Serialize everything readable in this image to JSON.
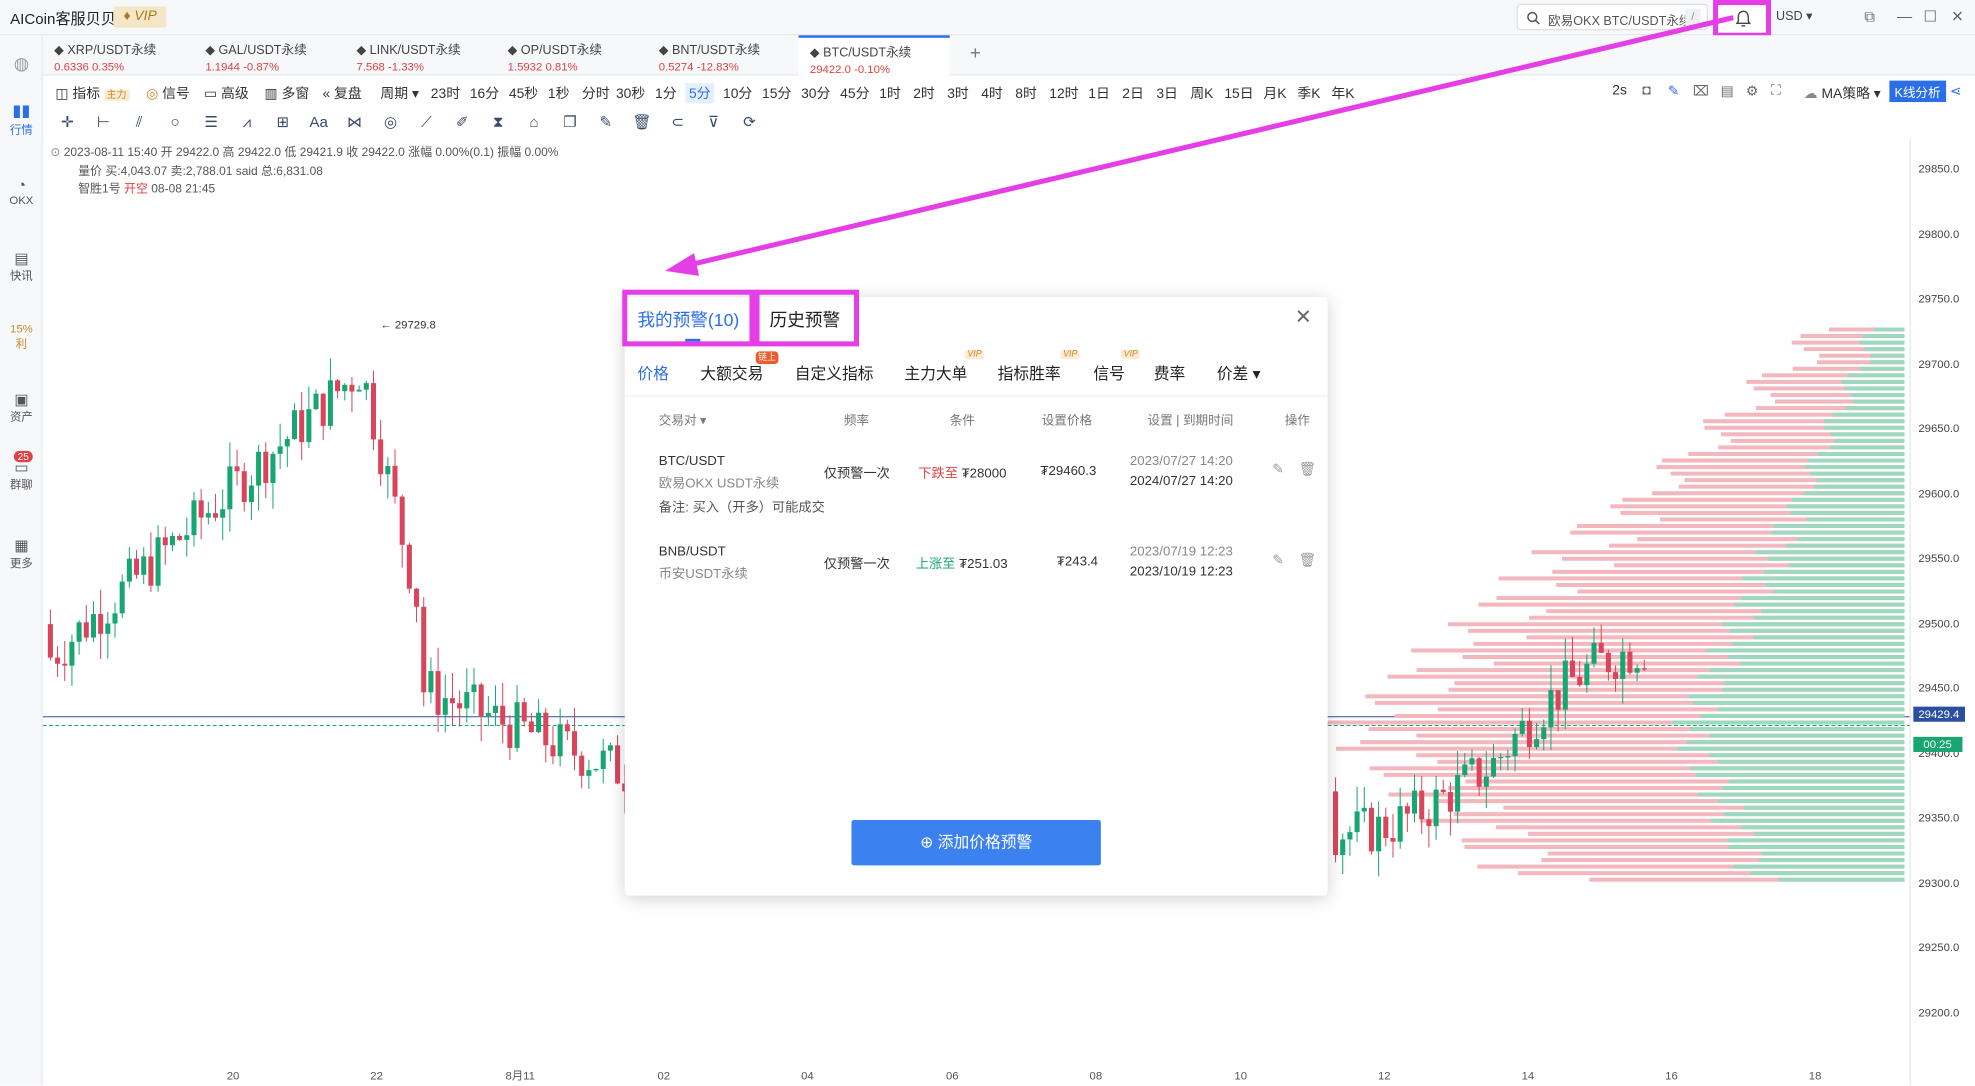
{
  "app": {
    "title": "AICoin客服贝贝",
    "vip": "VIP",
    "search_placeholder": "欧易OKX BTC/USDT永续",
    "search_shortcut": "/",
    "currency": "USD"
  },
  "tabs": [
    {
      "name": "XRP/USDT永续",
      "price": "0.6336",
      "change": "0.35%",
      "dir": "up"
    },
    {
      "name": "GAL/USDT永续",
      "price": "1.1944",
      "change": "-0.87%",
      "dir": "up"
    },
    {
      "name": "LINK/USDT永续",
      "price": "7.568",
      "change": "-1.33%",
      "dir": "up"
    },
    {
      "name": "OP/USDT永续",
      "price": "1.5932",
      "change": "0.81%",
      "dir": "up"
    },
    {
      "name": "BNT/USDT永续",
      "price": "0.5274",
      "change": "-12.83%",
      "dir": "up"
    },
    {
      "name": "BTC/USDT永续",
      "price": "29422.0",
      "change": "-0.10%",
      "dir": "up"
    }
  ],
  "toolbar": {
    "indicator": "指标",
    "main_badge": "主力",
    "signal": "信号",
    "advanced": "高级",
    "multi_window": "多窗",
    "replay": "复盘",
    "period": "周期",
    "intervals": [
      "23时",
      "16分",
      "45秒",
      "1秒",
      "分时",
      "30秒",
      "1分",
      "5分",
      "10分",
      "15分",
      "30分",
      "45分",
      "1时",
      "2时",
      "3时",
      "4时",
      "8时",
      "12时",
      "1日",
      "2日",
      "3日",
      "周K",
      "15日",
      "月K",
      "季K",
      "年K"
    ],
    "selected_interval": "5分",
    "refresh": "2s",
    "ma_strategy": "MA策略",
    "kline_analysis": "K线分析"
  },
  "leftrail": {
    "market": "行情",
    "okx": "OKX",
    "news": "快讯",
    "percent": "15%",
    "profit": "利",
    "assets": "资产",
    "chat": "群聊",
    "chat_badge": "25",
    "more": "更多"
  },
  "chart_info": {
    "line1": "2023-08-11 15:40  开 29422.0  高 29422.0  低 29421.9  收 29422.0  涨幅 0.00%(0.1)  振幅 0.00%",
    "line2": "量价 买:4,043.07 卖:2,788.01 said 总:6,831.08",
    "line3_name": "智胜1号",
    "line3_action": "开空",
    "line3_time": "08-08 21:45",
    "peak_label": "← 29729.8"
  },
  "price_axis": {
    "ticks": [
      "29850.0",
      "29800.0",
      "29750.0",
      "29700.0",
      "29650.0",
      "29600.0",
      "29550.0",
      "29500.0",
      "29450.0",
      "29400.0",
      "29350.0",
      "29300.0",
      "29250.0",
      "29200.0"
    ],
    "current_price": "29429.4",
    "countdown": "00:25"
  },
  "time_axis": [
    "20",
    "22",
    "8月11",
    "02",
    "04",
    "06",
    "08",
    "10",
    "12",
    "14",
    "16",
    "18"
  ],
  "modal": {
    "tab_mine": "我的预警(10)",
    "tab_history": "历史预警",
    "subtabs": [
      "价格",
      "大额交易",
      "自定义指标",
      "主力大单",
      "指标胜率",
      "信号",
      "费率",
      "价差"
    ],
    "chain_badge": "链上",
    "vip_badge": "VIP",
    "headers": [
      "交易对",
      "频率",
      "条件",
      "设置价格",
      "设置 | 到期时间",
      "操作"
    ],
    "rows": [
      {
        "pair": "BTC/USDT",
        "market": "欧易OKX USDT永续",
        "freq": "仅预警一次",
        "cond_label": "下跌至",
        "cond_value": "₮28000",
        "price": "₮29460.3",
        "set_time": "2023/07/27 14:20",
        "expire_time": "2024/07/27 14:20",
        "note": "备注: 买入（开多）可能成交",
        "dir": "down"
      },
      {
        "pair": "BNB/USDT",
        "market": "币安USDT永续",
        "freq": "仅预警一次",
        "cond_label": "上涨至",
        "cond_value": "₮251.03",
        "price": "₮243.4",
        "set_time": "2023/07/19 12:23",
        "expire_time": "2023/10/19 12:23",
        "dir": "up"
      }
    ],
    "add_button": "添加价格预警"
  },
  "colors": {
    "accent": "#2b6fe8",
    "highlight": "#e63ee6",
    "up": "#17a672",
    "down": "#e04141"
  }
}
